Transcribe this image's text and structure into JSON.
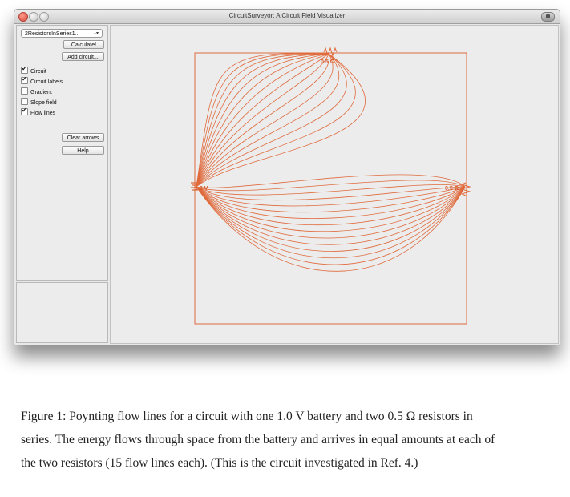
{
  "window": {
    "title": "CircuitSurveyor: A Circuit Field Visualizer"
  },
  "controls": {
    "circuit_select": "2ResistorsInSeries1...",
    "calculate_label": "Calculate!",
    "add_circuit_label": "Add circuit...",
    "checkboxes": [
      {
        "label": "Circuit",
        "checked": true
      },
      {
        "label": "Circuit labels",
        "checked": true
      },
      {
        "label": "Gradient",
        "checked": false
      },
      {
        "label": "Slope field",
        "checked": false
      },
      {
        "label": "Flow lines",
        "checked": true
      }
    ],
    "clear_arrows_label": "Clear arrows",
    "help_label": "Help"
  },
  "canvas": {
    "resistor_top_label": "0.5 Ω",
    "resistor_right_label": "0.5 Ω",
    "battery_label": "1.0 V",
    "line_color": "#e06a3c",
    "flow_lines_per_resistor": 15
  },
  "caption": {
    "text": "Figure 1: Poynting flow lines for a circuit with one 1.0 V battery and two 0.5 Ω resistors in series. The energy flows through space from the battery and arrives in equal amounts at each of the two resistors (15 flow lines each). (This is the circuit investigated in Ref. 4.)"
  }
}
